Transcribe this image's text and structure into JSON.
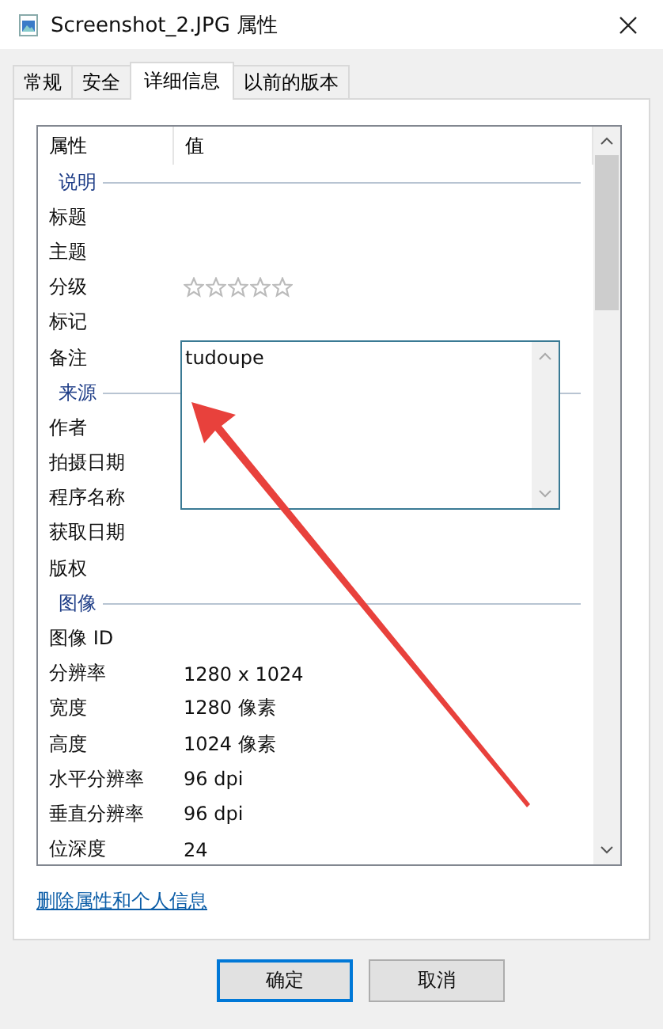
{
  "window": {
    "title": "Screenshot_2.JPG 属性"
  },
  "tabs": [
    {
      "label": "常规",
      "selected": false
    },
    {
      "label": "安全",
      "selected": false
    },
    {
      "label": "详细信息",
      "selected": true
    },
    {
      "label": "以前的版本",
      "selected": false
    }
  ],
  "list": {
    "columns": [
      "属性",
      "值"
    ],
    "items": [
      {
        "kind": "group",
        "label": "说明"
      },
      {
        "kind": "row",
        "name": "标题"
      },
      {
        "kind": "row",
        "name": "主题"
      },
      {
        "kind": "rating",
        "name": "分级",
        "stars": 0
      },
      {
        "kind": "row",
        "name": "标记"
      },
      {
        "kind": "row",
        "name": "备注"
      },
      {
        "kind": "group",
        "label": "来源"
      },
      {
        "kind": "row",
        "name": "作者"
      },
      {
        "kind": "row",
        "name": "拍摄日期"
      },
      {
        "kind": "row",
        "name": "程序名称"
      },
      {
        "kind": "row",
        "name": "获取日期"
      },
      {
        "kind": "row",
        "name": "版权"
      },
      {
        "kind": "group",
        "label": "图像"
      },
      {
        "kind": "row",
        "name": "图像 ID"
      },
      {
        "kind": "row",
        "name": "分辨率",
        "value": "1280 x 1024"
      },
      {
        "kind": "row",
        "name": "宽度",
        "value": "1280 像素"
      },
      {
        "kind": "row",
        "name": "高度",
        "value": "1024 像素"
      },
      {
        "kind": "row",
        "name": "水平分辨率",
        "value": "96 dpi"
      },
      {
        "kind": "row",
        "name": "垂直分辨率",
        "value": "96 dpi"
      },
      {
        "kind": "row",
        "name": "位深度",
        "value": "24"
      }
    ]
  },
  "comment_editor": {
    "value": "tudoupe"
  },
  "link": "删除属性和个人信息",
  "buttons": [
    {
      "label": "确定",
      "default": true
    },
    {
      "label": "取消",
      "default": false
    }
  ]
}
